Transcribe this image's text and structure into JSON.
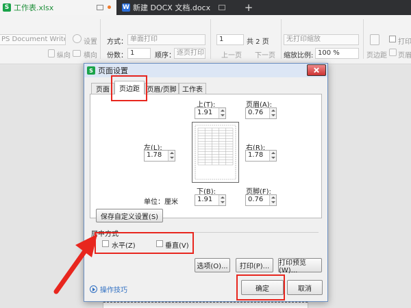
{
  "tabs": [
    {
      "label": "工作表.xlsx",
      "icon": "S"
    },
    {
      "label": "新建 DOCX 文档.docx",
      "icon": "W"
    }
  ],
  "ribbon": {
    "printer": "PS Document Writer",
    "settings": "设置",
    "portrait": "纵向",
    "landscape": "横向",
    "mode_label": "方式：",
    "mode_value": "单面打印",
    "copies_label": "份数：",
    "copies_value": "1",
    "order_label": "顺序：",
    "order_value": "逐页打印",
    "page_value": "1",
    "total_pages": "共 2 页",
    "prev_page": "上一页",
    "next_page": "下一页",
    "no_print_scale": "无打印缩放",
    "zoom_label": "缩放比例:",
    "zoom_value": "100 %",
    "margins": "页边距",
    "print_gridlines": "打印网",
    "header_footer": "页眉"
  },
  "dialog": {
    "title": "页面设置",
    "tabs": [
      "页面",
      "页边距",
      "页眉/页脚",
      "工作表"
    ],
    "top_label": "上(T):",
    "top_value": "1.91",
    "header_label": "页眉(A):",
    "header_value": "0.76",
    "left_label": "左(L):",
    "left_value": "1.78",
    "right_label": "右(R):",
    "right_value": "1.78",
    "unit_label": "单位：厘米",
    "bottom_label": "下(B):",
    "bottom_value": "1.91",
    "footer_label": "页脚(F):",
    "footer_value": "0.76",
    "save_custom": "保存自定义设置(S)",
    "center_group": "居中方式",
    "horizontal": "水平(Z)",
    "vertical": "垂直(V)",
    "options": "选项(O)...",
    "print": "打印(P)...",
    "print_preview": "打印预览(W)...",
    "tips": "操作技巧",
    "ok": "确定",
    "cancel": "取消"
  },
  "colors": {
    "highlight": "#e8261e",
    "accent_green": "#1aa34a",
    "link": "#2f6fc2"
  }
}
